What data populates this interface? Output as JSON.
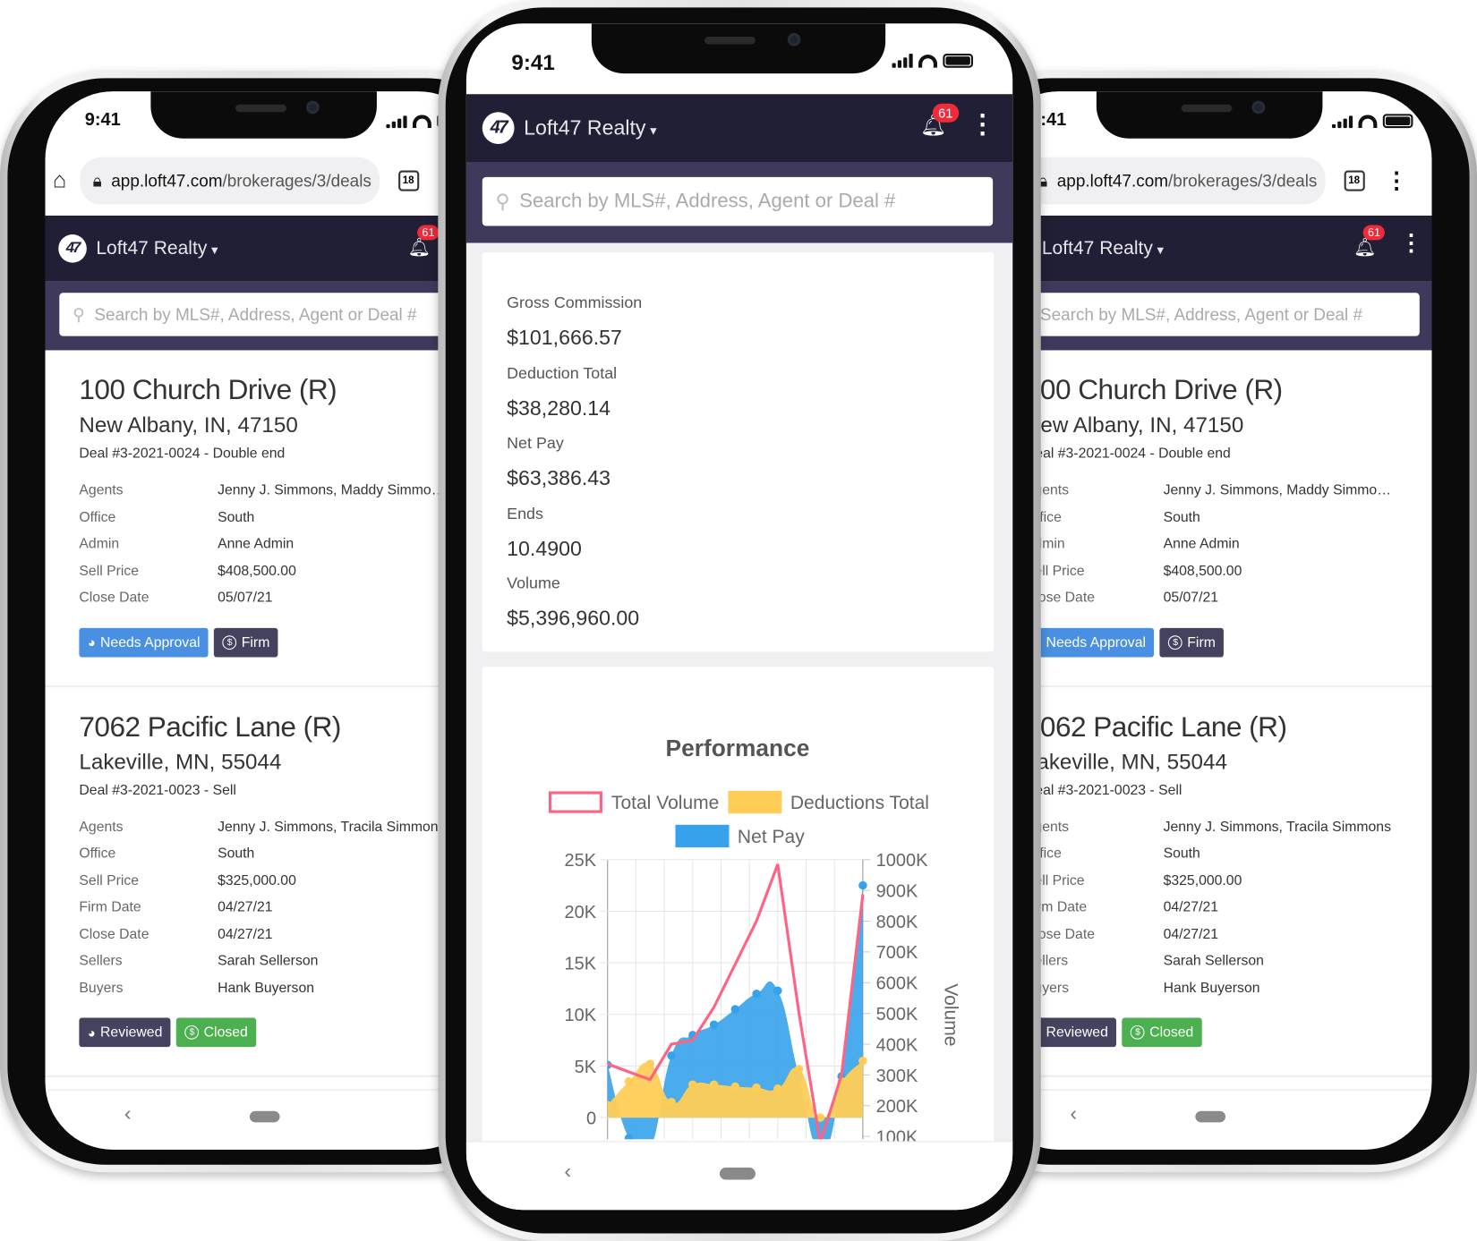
{
  "status_time": "9:41",
  "browser": {
    "url_host": "app.loft47.com",
    "url_path": "/brokerages/3/deals",
    "tab_count": "18"
  },
  "app": {
    "logo": "47",
    "brand": "Loft47 Realty",
    "notifications": "61",
    "search_placeholder": "Search by MLS#, Address, Agent or Deal #"
  },
  "deals": [
    {
      "title": "100 Church Drive (R)",
      "city": "New Albany, IN, 47150",
      "deal_number": "Deal #3-2021-0024 - Double end",
      "fields": [
        {
          "label": "Agents",
          "value": "Jenny J. Simmons, Maddy Simmons, ..."
        },
        {
          "label": "Office",
          "value": "South"
        },
        {
          "label": "Admin",
          "value": "Anne Admin"
        },
        {
          "label": "Sell Price",
          "value": "$408,500.00"
        },
        {
          "label": "Close Date",
          "value": "05/07/21"
        }
      ],
      "badges": [
        {
          "label": "Needs Approval",
          "icon": "pie-clock-icon",
          "color": "#4a90e2"
        },
        {
          "label": "Firm",
          "icon": "dollar-circle-icon",
          "color": "#45425f"
        }
      ]
    },
    {
      "title": "7062 Pacific Lane (R)",
      "city": "Lakeville, MN, 55044",
      "deal_number": "Deal #3-2021-0023 - Sell",
      "fields": [
        {
          "label": "Agents",
          "value": "Jenny J. Simmons, Tracila Simmons"
        },
        {
          "label": "Office",
          "value": "South"
        },
        {
          "label": "Sell Price",
          "value": "$325,000.00"
        },
        {
          "label": "Firm Date",
          "value": "04/27/21"
        },
        {
          "label": "Close Date",
          "value": "04/27/21"
        },
        {
          "label": "Sellers",
          "value": "Sarah Sellerson"
        },
        {
          "label": "Buyers",
          "value": "Hank Buyerson"
        }
      ],
      "badges": [
        {
          "label": "Reviewed",
          "icon": "pie-clock-icon",
          "color": "#45425f"
        },
        {
          "label": "Closed",
          "icon": "dollar-circle-icon",
          "color": "#4caf50"
        }
      ]
    }
  ],
  "summary": [
    {
      "label": "Gross Commission",
      "value": "$101,666.57"
    },
    {
      "label": "Deduction Total",
      "value": "$38,280.14"
    },
    {
      "label": "Net Pay",
      "value": "$63,386.43"
    },
    {
      "label": "Ends",
      "value": "10.4900"
    },
    {
      "label": "Volume",
      "value": "$5,396,960.00"
    }
  ],
  "colors": {
    "header": "#211f35",
    "search_band": "#3f3a5c",
    "notification": "#ef2b3a"
  },
  "chart_data": {
    "type": "line",
    "title": "Performance",
    "legend": "top",
    "grid": true,
    "left_axis": {
      "ylim": [
        0,
        25000
      ],
      "ticks": [
        "25K",
        "20K",
        "15K",
        "10K",
        "5K",
        "0"
      ]
    },
    "right_axis": {
      "label": "Volume",
      "ylim": [
        100000,
        1000000
      ],
      "ticks": [
        "1000K",
        "900K",
        "800K",
        "700K",
        "600K",
        "500K",
        "400K",
        "300K",
        "200K",
        "100K"
      ]
    },
    "series": [
      {
        "name": "Total Volume",
        "axis": "right",
        "style": "line",
        "color": "#ff6384",
        "values": [
          336000,
          310000,
          285000,
          400000,
          413000,
          520000,
          660000,
          800000,
          985000,
          500000,
          80000,
          300000,
          887000
        ]
      },
      {
        "name": "Deductions Total",
        "axis": "left",
        "style": "area",
        "color": "#ffcd56",
        "values": [
          1200,
          3500,
          5200,
          1500,
          3200,
          3200,
          3000,
          2900,
          2800,
          4700,
          0,
          3500,
          5500
        ]
      },
      {
        "name": "Net Pay",
        "axis": "left",
        "style": "area",
        "color": "#36a2eb",
        "values": [
          5100,
          -2000,
          -3000,
          6000,
          8000,
          9000,
          10500,
          12000,
          12300,
          4000,
          -3000,
          4000,
          22500
        ]
      }
    ]
  }
}
